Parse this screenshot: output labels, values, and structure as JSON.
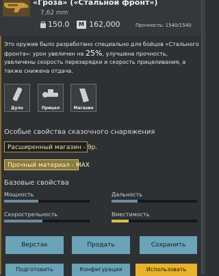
{
  "header": {
    "title": "«Гроза» («Стальной фронт»)",
    "caliber": "7,62 mm",
    "weight": "150.0",
    "price_icon": "M",
    "price": "162,000",
    "durability": "Прочность: 1540/1540"
  },
  "description": {
    "part1": "Это оружие было разработано специально для бойцов «Стального фронта»: урон увеличен на ",
    "percent": "25%",
    "part2": ", улучшена прочность, увеличены скорость перезарядки и скорость прицеливания, а также снижена отдача."
  },
  "slots": [
    {
      "label": "Дуло",
      "icon": "muzzle-icon"
    },
    {
      "label": "Прицел",
      "icon": "scope-icon"
    },
    {
      "label": "Магазин",
      "icon": "magazine-icon"
    }
  ],
  "special": {
    "title": "Особые свойства сказочного снаряжения",
    "tags": [
      "Расширенный магазин - 9р.",
      "Прочный материал - MAX"
    ]
  },
  "base": {
    "title": "Базовые свойства",
    "stats": [
      {
        "label": "Мощность",
        "value": 0.4
      },
      {
        "label": "Дальность",
        "value": 0.3
      },
      {
        "label": "Скорострельность",
        "value": 0.45
      },
      {
        "label": "Вместимость",
        "value": 0.2
      }
    ]
  },
  "buttons": {
    "workbench": "Верстак",
    "sell": "Продать",
    "save": "Сохранить",
    "bottom": [
      "Подготовить",
      "Конфигурация",
      "Использовать"
    ]
  },
  "colors": {
    "accent": "#6ba3b8",
    "gold": "#e8b32a",
    "bar_fill": "#6e8aa0",
    "bar_accent": "#d8c040"
  }
}
